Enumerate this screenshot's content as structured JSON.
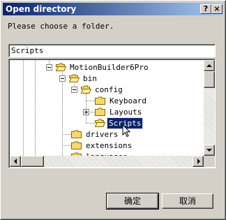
{
  "window": {
    "title": "Open directory"
  },
  "prompt": "Please choose a folder.",
  "folder_field": {
    "value": "Scripts"
  },
  "tree": {
    "items": [
      {
        "label": "MotionBuilder6Pro",
        "expander": "minus"
      },
      {
        "label": "bin",
        "expander": "minus"
      },
      {
        "label": "config",
        "expander": "minus"
      },
      {
        "label": "Keyboard",
        "expander": "none"
      },
      {
        "label": "Layouts",
        "expander": "plus"
      },
      {
        "label": "Scripts",
        "expander": "none",
        "selected": true
      },
      {
        "label": "drivers",
        "expander": "none"
      },
      {
        "label": "extensions",
        "expander": "none"
      },
      {
        "label": "languages",
        "expander": "none"
      }
    ]
  },
  "buttons": {
    "ok": "确定",
    "cancel": "取消"
  },
  "colors": {
    "selection": "#0a246a",
    "folder": "#f6d86b",
    "title_start": "#0a246a"
  }
}
